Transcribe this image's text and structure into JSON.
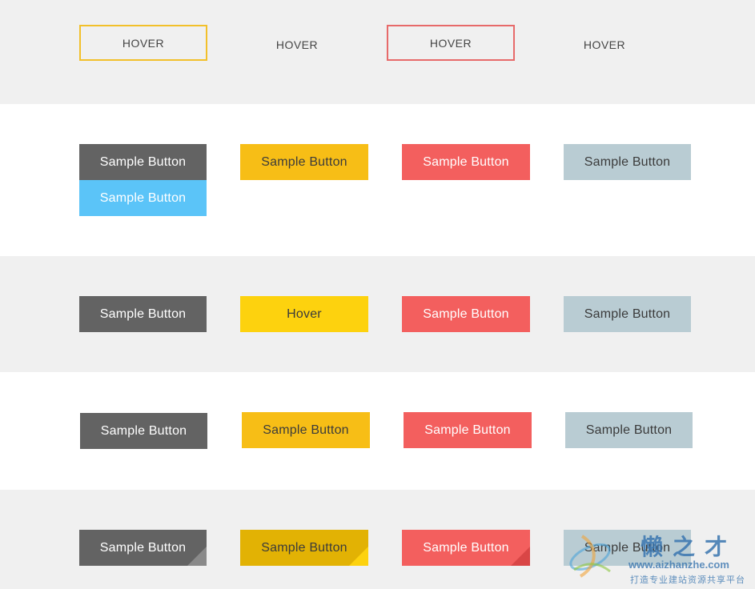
{
  "hover_row": {
    "buttons": [
      {
        "label": "HOVER",
        "border_color": "#f2c02a"
      },
      {
        "label": "HOVER",
        "border_color": ""
      },
      {
        "label": "HOVER",
        "border_color": "#e76a6a"
      },
      {
        "label": "HOVER",
        "border_color": ""
      }
    ]
  },
  "row2": {
    "buttons": [
      {
        "label": "Sample Button",
        "color": "#636363"
      },
      {
        "label": "Sample Button",
        "color": "#5bc4f8"
      },
      {
        "label": "Sample Button",
        "color": "#f7be16"
      },
      {
        "label": "Sample Button",
        "color": "#f35f5e"
      },
      {
        "label": "Sample Button",
        "color": "#b9ccd3"
      }
    ]
  },
  "row3": {
    "buttons": [
      {
        "label": "Sample Button",
        "color": "#636363"
      },
      {
        "label": "Hover",
        "color": "#fdd20e"
      },
      {
        "label": "Sample Button",
        "color": "#f35f5e"
      },
      {
        "label": "Sample Button",
        "color": "#b9ccd3"
      }
    ]
  },
  "row4": {
    "buttons": [
      {
        "label": "Sample Button",
        "color": "#636363"
      },
      {
        "label": "Sample Button",
        "color": "#f7be16"
      },
      {
        "label": "Sample Button",
        "color": "#f35f5e"
      },
      {
        "label": "Sample Button",
        "color": "#b9ccd3"
      }
    ]
  },
  "row5": {
    "buttons": [
      {
        "label": "Sample Button",
        "color": "#636363",
        "fold_color": "#8a8a8a"
      },
      {
        "label": "Sample Button",
        "color": "#e2b204",
        "fold_color": "#fdd20e"
      },
      {
        "label": "Sample Button",
        "color": "#f35f5e",
        "fold_color": "#d94646"
      },
      {
        "label": "Sample Button",
        "color": "#b9ccd3",
        "fold_color": ""
      }
    ]
  },
  "watermark": {
    "title": "懒之才",
    "url": "www.aizhanzhe.com",
    "slogan": "打造专业建站资源共享平台"
  }
}
